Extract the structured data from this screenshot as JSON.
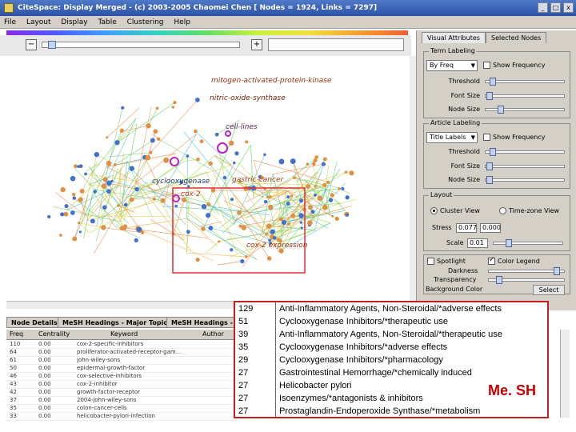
{
  "window": {
    "title": "CiteSpace: Display Merged - (c) 2003-2005 Chaomei Chen [ Nodes = 1924, Links = 7297]",
    "controls": [
      "_",
      "□",
      "x"
    ]
  },
  "menu": [
    "File",
    "Layout",
    "Display",
    "Table",
    "Clustering",
    "Help"
  ],
  "panel": {
    "tabs": [
      "Visual Attributes",
      "Selected Nodes"
    ],
    "term_labeling": {
      "title": "Term Labeling",
      "combo": "By Freq",
      "show_frequency": "Show Frequency",
      "threshold": "Threshold",
      "font_size": "Font Size",
      "node_size": "Node Size"
    },
    "article_labeling": {
      "title": "Article Labeling",
      "combo": "Title Labels",
      "show_frequency": "Show Frequency",
      "threshold": "Threshold",
      "font_size": "Font Size",
      "node_size": "Node Size"
    },
    "layout": {
      "title": "Layout",
      "cluster_view": "Cluster View",
      "time_zone_view": "Time-zone View",
      "stress": "Stress",
      "stress_value": "0.077",
      "stress_value2": "0.000",
      "scale": "Scale",
      "scale_value": "0.01"
    },
    "display": {
      "spotlight": "Spotlight",
      "color_legend": "Color Legend",
      "darkness": "Darkness",
      "transparency": "Transparency",
      "background_color": "Background Color",
      "select": "Select"
    }
  },
  "visualization": {
    "labels": [
      "mitogen-activated-protein-kinase",
      "nitric-oxide-synthase",
      "cell-lines",
      "cyclooxygenase",
      "gastric-cancer",
      "cox-2",
      "cox-2 expression"
    ]
  },
  "bottom": {
    "tabs": [
      "Node Details",
      "MeSH Headings - Major Topics",
      "MeSH Headings - Mi"
    ],
    "columns": [
      "Freq",
      "Centrality",
      "Keyword",
      "Author"
    ],
    "rows": [
      {
        "freq": "110",
        "centrality": "0.00",
        "keyword": "cox-2-specific-inhibitors"
      },
      {
        "freq": "64",
        "centrality": "0.00",
        "keyword": "proliferator-activated-receptor-gam..."
      },
      {
        "freq": "61",
        "centrality": "0.00",
        "keyword": "john-wiley-sons"
      },
      {
        "freq": "50",
        "centrality": "0.00",
        "keyword": "epidermal-growth-factor"
      },
      {
        "freq": "46",
        "centrality": "0.00",
        "keyword": "cox-selective-inhibitors"
      },
      {
        "freq": "43",
        "centrality": "0.00",
        "keyword": "cox-2-inhibitor"
      },
      {
        "freq": "42",
        "centrality": "0.00",
        "keyword": "growth-factor-receptor"
      },
      {
        "freq": "37",
        "centrality": "0.00",
        "keyword": "2004-john-wiley-sons"
      },
      {
        "freq": "35",
        "centrality": "0.00",
        "keyword": "colon-cancer-cells"
      },
      {
        "freq": "33",
        "centrality": "0.00",
        "keyword": "helicobacter-pylori-infection"
      }
    ]
  },
  "mesh": {
    "title": "Me. SH",
    "rows": [
      {
        "freq": "129",
        "term": "Anti-Inflammatory Agents, Non-Steroidal/*adverse effects"
      },
      {
        "freq": "51",
        "term": "Cyclooxygenase Inhibitors/*therapeutic use"
      },
      {
        "freq": "39",
        "term": "Anti-Inflammatory Agents, Non-Steroidal/*therapeutic use"
      },
      {
        "freq": "35",
        "term": "Cyclooxygenase Inhibitors/*adverse effects"
      },
      {
        "freq": "29",
        "term": "Cyclooxygenase Inhibitors/*pharmacology"
      },
      {
        "freq": "27",
        "term": "Gastrointestinal Hemorrhage/*chemically induced"
      },
      {
        "freq": "27",
        "term": "Helicobacter pylori"
      },
      {
        "freq": "27",
        "term": "Isoenzymes/*antagonists & inhibitors"
      },
      {
        "freq": "27",
        "term": "Prostaglandin-Endoperoxide Synthase/*metabolism"
      }
    ]
  },
  "colors": {
    "titlebar": "#2c52a8",
    "highlight_box": "#e03030",
    "mesh_title": "#c00000"
  }
}
